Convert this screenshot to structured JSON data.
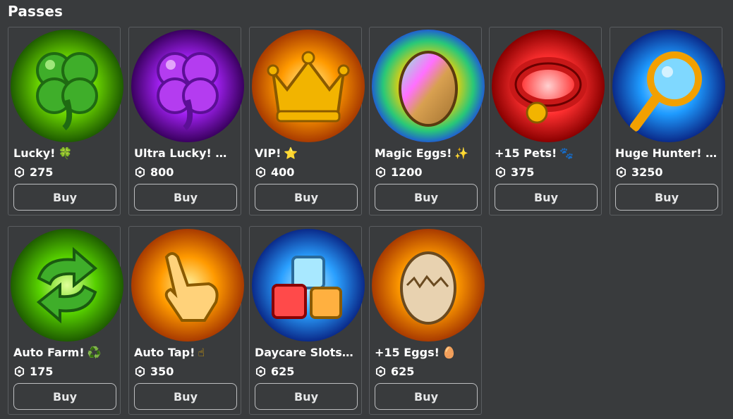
{
  "section": {
    "title": "Passes"
  },
  "passes": [
    {
      "name": "Lucky!",
      "emoji": "🍀",
      "emoji_color": "#2ecc40",
      "price": "275",
      "buy_label": "Buy",
      "icon": "four-leaf-clover-icon",
      "bg": "#6ad400"
    },
    {
      "name": "Ultra Lucky! …",
      "emoji": "",
      "emoji_color": "",
      "price": "800",
      "buy_label": "Buy",
      "icon": "purple-clover-icon",
      "bg": "#a020f0"
    },
    {
      "name": "VIP!",
      "emoji": "⭐",
      "emoji_color": "#f5c518",
      "price": "400",
      "buy_label": "Buy",
      "icon": "vip-crown-icon",
      "bg": "#ff9a00"
    },
    {
      "name": "Magic Eggs!",
      "emoji": "✨",
      "emoji_color": "#f5c518",
      "price": "1200",
      "buy_label": "Buy",
      "icon": "rainbow-egg-icon",
      "bg": "#ffd000"
    },
    {
      "name": "+15 Pets!",
      "emoji": "🐾",
      "emoji_color": "#5b5fd6",
      "price": "375",
      "buy_label": "Buy",
      "icon": "pet-collar-icon",
      "bg": "#ff3030"
    },
    {
      "name": "Huge Hunter! …",
      "emoji": "",
      "emoji_color": "",
      "price": "3250",
      "buy_label": "Buy",
      "icon": "magnifying-glass-icon",
      "bg": "#1e9bff"
    },
    {
      "name": "Auto Farm!",
      "emoji": "♻️",
      "emoji_color": "#2ecc40",
      "price": "175",
      "buy_label": "Buy",
      "icon": "recycle-arrows-icon",
      "bg": "#57d100"
    },
    {
      "name": "Auto Tap!",
      "emoji": "☝",
      "emoji_color": "#f5b300",
      "price": "350",
      "buy_label": "Buy",
      "icon": "pointing-hand-icon",
      "bg": "#ff9a00"
    },
    {
      "name": "Daycare Slots…",
      "emoji": "",
      "emoji_color": "",
      "price": "625",
      "buy_label": "Buy",
      "icon": "toy-blocks-icon",
      "bg": "#2aa0ff"
    },
    {
      "name": "+15 Eggs!",
      "emoji": "🥚",
      "emoji_color": "#e8b27a",
      "price": "625",
      "buy_label": "Buy",
      "icon": "cracked-egg-icon",
      "bg": "#ff9a00"
    }
  ]
}
